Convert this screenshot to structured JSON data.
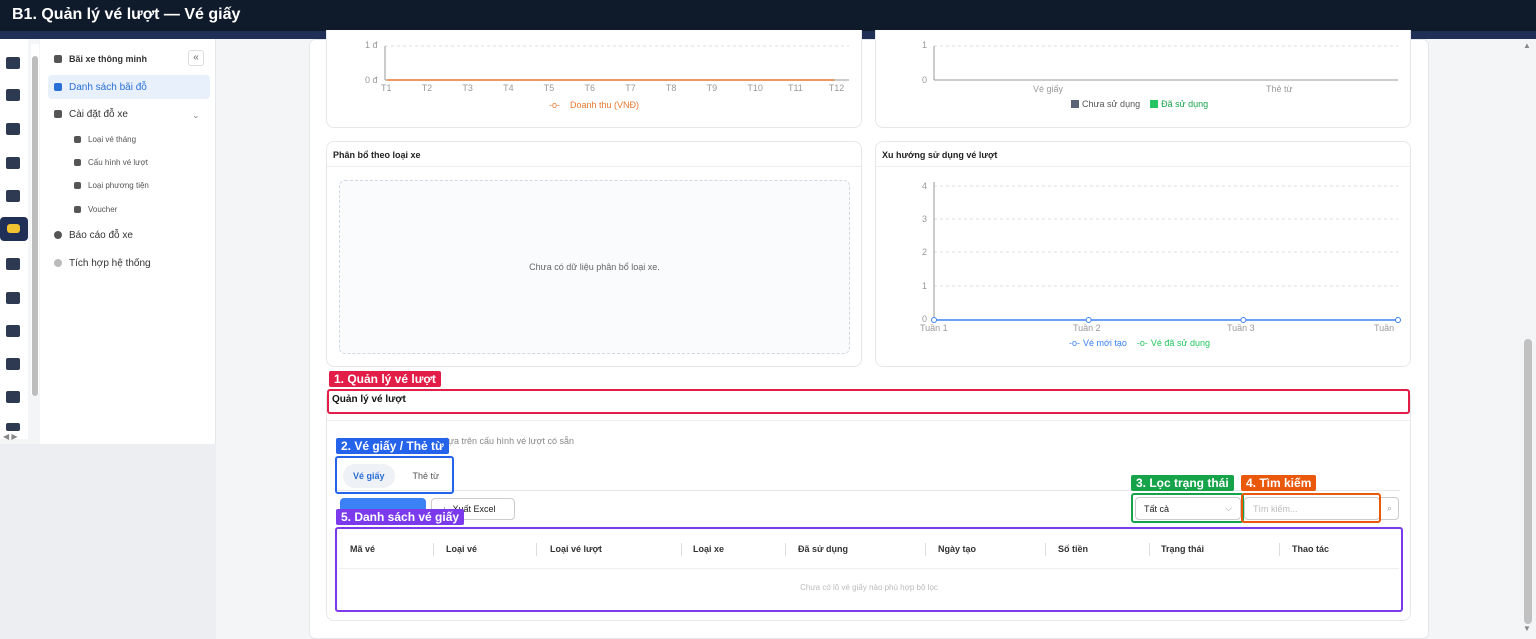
{
  "window": {
    "title": "B1. Quản lý vé lượt — Vé giấy"
  },
  "sidebar": {
    "items": [
      {
        "label": "Bãi xe thông minh",
        "icon": "car-icon"
      },
      {
        "label": "Danh sách bãi đỗ",
        "icon": "list-icon",
        "active": true
      },
      {
        "label": "Cài đặt đỗ xe",
        "icon": "settings-icon"
      },
      {
        "label": "Loại vé tháng",
        "icon": "calendar-icon"
      },
      {
        "label": "Cấu hình vé lượt",
        "icon": "ticket-icon"
      },
      {
        "label": "Loại phương tiện",
        "icon": "car-icon"
      },
      {
        "label": "Voucher",
        "icon": "voucher-icon"
      },
      {
        "label": "Báo cáo đỗ xe",
        "icon": "report-icon"
      },
      {
        "label": "Tích hợp hệ thống",
        "icon": "integration-icon"
      }
    ]
  },
  "charts": {
    "revenue": {
      "y_tick_top": "1 đ",
      "y_tick_bottom": "0 đ",
      "months": [
        "T1",
        "T2",
        "T3",
        "T4",
        "T5",
        "T6",
        "T7",
        "T8",
        "T9",
        "T10",
        "T11",
        "T12"
      ],
      "legend": "Doanh thu (VNĐ)",
      "color": "#e8772e",
      "values": [
        0,
        0,
        0,
        0,
        0,
        0,
        0,
        0,
        0,
        0,
        0,
        0
      ]
    },
    "status": {
      "y_tick_top": "1",
      "y_tick_bottom": "0",
      "categories": [
        "Vé giấy",
        "Thẻ từ"
      ],
      "legend_unused": "Chưa sử dụng",
      "legend_used": "Đã sử dụng",
      "color_unused": "#5b6475",
      "color_used": "#22c55e"
    },
    "distribution": {
      "title": "Phân bổ theo loại xe",
      "empty": "Chưa có dữ liệu phân bổ loại xe."
    },
    "trend": {
      "title": "Xu hướng sử dụng vé lượt",
      "y_ticks": [
        "4",
        "3",
        "2",
        "1",
        "0"
      ],
      "weeks": [
        "Tuần 1",
        "Tuần 2",
        "Tuần 3",
        "Tuần"
      ],
      "legend_new": "Vé mới tạo",
      "legend_used": "Vé đã sử dụng",
      "color_new": "#3b82f6",
      "color_used": "#22c55e",
      "values_new": [
        0,
        0,
        0,
        0
      ]
    }
  },
  "section": {
    "title": "Quản lý vé lượt",
    "description": "dựa trên cấu hình vé lượt có sẵn",
    "tabs": [
      "Vé giấy",
      "Thẻ từ"
    ],
    "export_label": "Xuất Excel",
    "status_filter": "Tất cả",
    "search_placeholder": "Tìm kiếm..."
  },
  "table": {
    "columns": [
      "Mã vé",
      "Loại vé",
      "Loại vé lượt",
      "Loại xe",
      "Đã sử dụng",
      "Ngày tạo",
      "Số tiền",
      "Trạng thái",
      "Thao tác"
    ],
    "empty": "Chưa có lô vé giấy nào phù hợp bộ lọc"
  },
  "annotations": [
    {
      "label": "1. Quản lý vé lượt",
      "color": "#e11d48"
    },
    {
      "label": "2. Vé giấy / Thẻ từ",
      "color": "#2563eb"
    },
    {
      "label": "3. Lọc trạng thái",
      "color": "#16a34a"
    },
    {
      "label": "4. Tìm kiếm",
      "color": "#ea580c"
    },
    {
      "label": "5. Danh sách vé giấy",
      "color": "#7c3aed"
    }
  ]
}
